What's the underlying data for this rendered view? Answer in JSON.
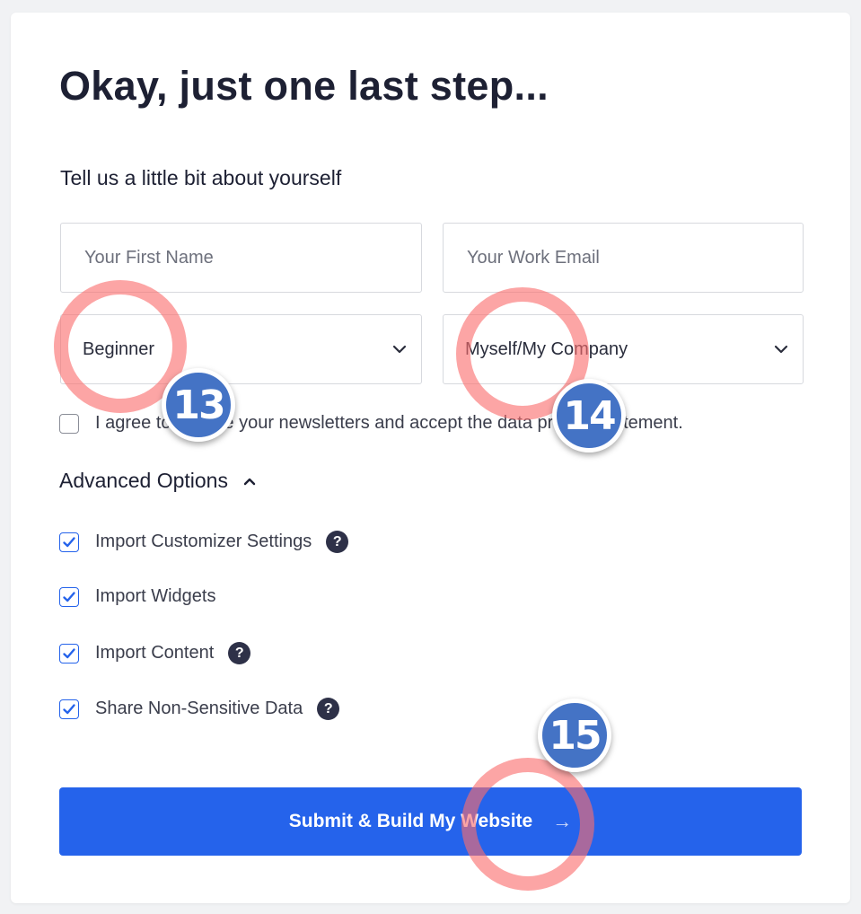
{
  "page": {
    "title": "Okay, just one last step...",
    "subtitle": "Tell us a little bit about yourself"
  },
  "form": {
    "first_name": {
      "placeholder": "Your First Name",
      "value": ""
    },
    "work_email": {
      "placeholder": "Your Work Email",
      "value": ""
    },
    "experience_select": {
      "selected": "Beginner"
    },
    "site_for_select": {
      "selected": "Myself/My Company"
    },
    "consent": {
      "label": "I agree to receive your newsletters and accept the data privacy statement.",
      "checked": false
    }
  },
  "advanced": {
    "label": "Advanced Options",
    "expanded": true,
    "options": [
      {
        "label": "Import Customizer Settings",
        "checked": true,
        "help": true
      },
      {
        "label": "Import Widgets",
        "checked": true,
        "help": false
      },
      {
        "label": "Import Content",
        "checked": true,
        "help": true
      },
      {
        "label": "Share Non-Sensitive Data",
        "checked": true,
        "help": true
      }
    ],
    "help_glyph": "?"
  },
  "submit": {
    "label": "Submit & Build My Website",
    "arrow": "→"
  },
  "annotations": [
    {
      "number": "13"
    },
    {
      "number": "14"
    },
    {
      "number": "15"
    }
  ],
  "colors": {
    "primary": "#2563eb",
    "annotation_ring": "#fa6e6e",
    "annotation_badge": "#4473c5"
  }
}
